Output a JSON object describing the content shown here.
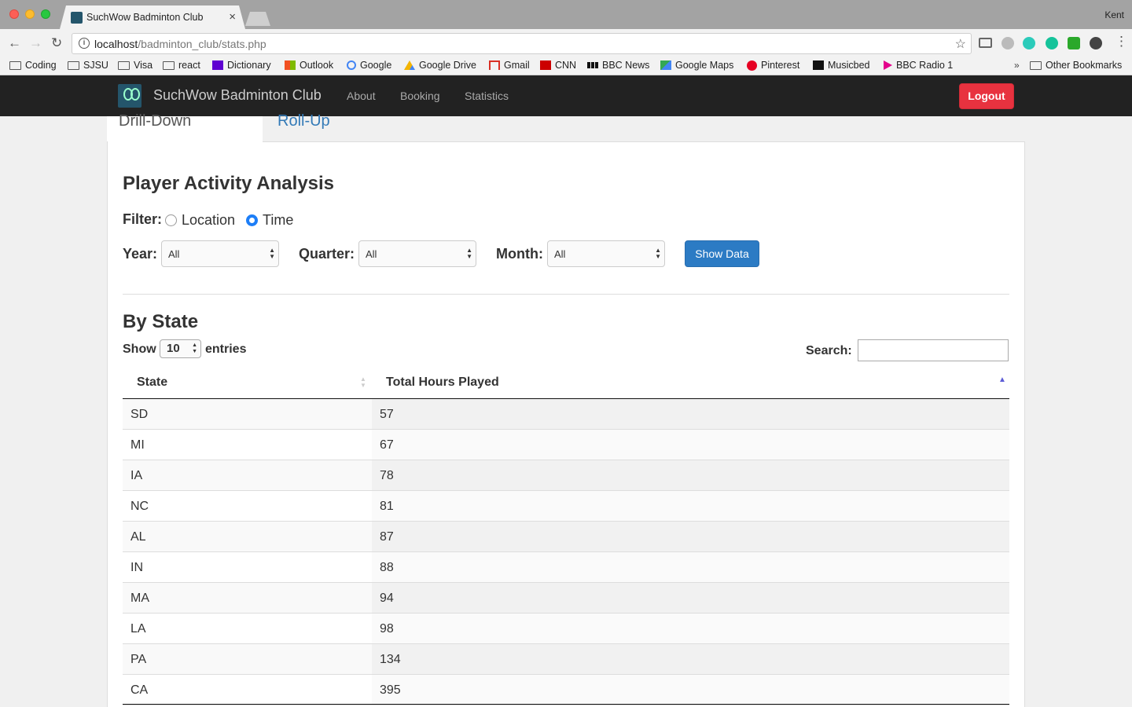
{
  "browser": {
    "tab_title": "SuchWow Badminton Club",
    "tab_close": "×",
    "profile": "Kent",
    "url_host": "localhost",
    "url_path": "/badminton_club/stats.php"
  },
  "bookmarks": [
    {
      "label": "Coding",
      "icon": "folder-icon"
    },
    {
      "label": "SJSU",
      "icon": "folder-icon"
    },
    {
      "label": "Visa",
      "icon": "folder-icon"
    },
    {
      "label": "react",
      "icon": "folder-icon"
    },
    {
      "label": "Dictionary",
      "icon": "yahoo-icon"
    },
    {
      "label": "Outlook",
      "icon": "outlook-icon"
    },
    {
      "label": "Google",
      "icon": "google-icon"
    },
    {
      "label": "Google Drive",
      "icon": "drive-icon"
    },
    {
      "label": "Gmail",
      "icon": "gmail-icon"
    },
    {
      "label": "CNN",
      "icon": "cnn-icon"
    },
    {
      "label": "BBC News",
      "icon": "bbc-icon"
    },
    {
      "label": "Google Maps",
      "icon": "maps-icon"
    },
    {
      "label": "Pinterest",
      "icon": "pinterest-icon"
    },
    {
      "label": "Musicbed",
      "icon": "musicbed-icon"
    },
    {
      "label": "BBC Radio 1",
      "icon": "radio-icon"
    }
  ],
  "bookmarks_overflow": "»",
  "other_bookmarks": "Other Bookmarks",
  "site": {
    "brand": "SuchWow Badminton Club",
    "nav": [
      "About",
      "Booking",
      "Statistics"
    ],
    "logout": "Logout"
  },
  "tabs": {
    "active": "Drill-Down",
    "other": "Roll-Up"
  },
  "analysis": {
    "title": "Player Activity Analysis",
    "filter_label": "Filter:",
    "filter_options": [
      "Location",
      "Time"
    ],
    "filter_selected": "Time",
    "year_label": "Year:",
    "year_value": "All",
    "quarter_label": "Quarter:",
    "quarter_value": "All",
    "month_label": "Month:",
    "month_value": "All",
    "show_button": "Show Data"
  },
  "table": {
    "title": "By State",
    "show_label": "Show",
    "page_length": "10",
    "entries_label": "entries",
    "search_label": "Search:",
    "search_value": "",
    "columns": [
      "State",
      "Total Hours Played"
    ],
    "rows": [
      {
        "state": "SD",
        "hours": "57"
      },
      {
        "state": "MI",
        "hours": "67"
      },
      {
        "state": "IA",
        "hours": "78"
      },
      {
        "state": "NC",
        "hours": "81"
      },
      {
        "state": "AL",
        "hours": "87"
      },
      {
        "state": "IN",
        "hours": "88"
      },
      {
        "state": "MA",
        "hours": "94"
      },
      {
        "state": "LA",
        "hours": "98"
      },
      {
        "state": "PA",
        "hours": "134"
      },
      {
        "state": "CA",
        "hours": "395"
      }
    ]
  },
  "colors": {
    "navbar": "#222222",
    "logout": "#e8323f",
    "primary": "#2c7bc4",
    "link": "#337ab7"
  }
}
